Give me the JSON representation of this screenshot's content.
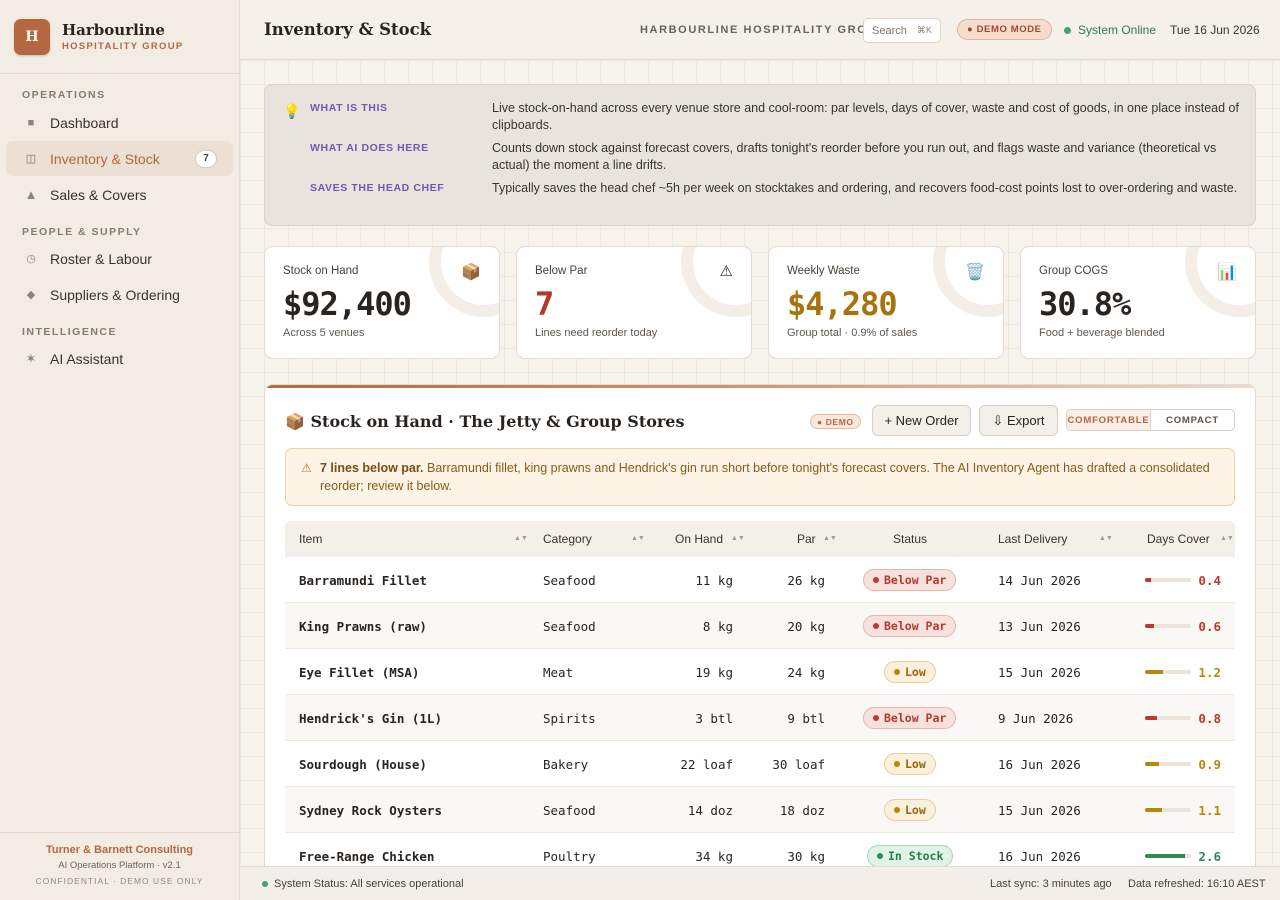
{
  "brand": {
    "initial": "H",
    "name": "Harbourline",
    "sub": "HOSPITALITY GROUP"
  },
  "sidebar": {
    "sections": [
      {
        "label": "OPERATIONS"
      },
      {
        "label": "PEOPLE & SUPPLY"
      },
      {
        "label": "INTELLIGENCE"
      }
    ],
    "items": [
      {
        "label": "Dashboard",
        "icon": "square-icon"
      },
      {
        "label": "Inventory & Stock",
        "icon": "layout-icon",
        "badge": "7",
        "active": true
      },
      {
        "label": "Sales & Covers",
        "icon": "triangle-icon"
      },
      {
        "label": "Roster & Labour",
        "icon": "clock-icon"
      },
      {
        "label": "Suppliers & Ordering",
        "icon": "diamond-icon"
      },
      {
        "label": "AI Assistant",
        "icon": "sparkle-icon"
      }
    ],
    "footer": {
      "company": "Turner & Barnett Consulting",
      "platform": "AI Operations Platform · v2.1",
      "note": "CONFIDENTIAL · DEMO USE ONLY"
    }
  },
  "header": {
    "title": "Inventory & Stock",
    "org": "HARBOURLINE HOSPITALITY GROUP",
    "search_label": "Search",
    "search_shortcut": "⌘K",
    "demo_mode": "● DEMO MODE",
    "system_status": "System Online",
    "date": "Tue 16 Jun 2026"
  },
  "info": {
    "rows": [
      {
        "key": "WHAT IS THIS",
        "value": "Live stock-on-hand across every venue store and cool-room: par levels, days of cover, waste and cost of goods, in one place instead of clipboards."
      },
      {
        "key": "WHAT AI DOES HERE",
        "value": "Counts down stock against forecast covers, drafts tonight's reorder before you run out, and flags waste and variance (theoretical vs actual) the moment a line drifts."
      },
      {
        "key": "SAVES THE HEAD CHEF",
        "value": "Typically saves the head chef ~5h per week on stocktakes and ordering, and recovers food-cost points lost to over-ordering and waste."
      }
    ]
  },
  "kpis": [
    {
      "label": "Stock on Hand",
      "icon": "package-icon",
      "value": "$92,400",
      "sub": "Across 5 venues",
      "color": "#2a2420"
    },
    {
      "label": "Below Par",
      "icon": "warning-icon",
      "value": "7",
      "sub": "Lines need reorder today",
      "color": "#b13a2c"
    },
    {
      "label": "Weekly Waste",
      "icon": "trash-icon",
      "value": "$4,280",
      "sub": "Group total · 0.9% of sales",
      "color": "#a8720c"
    },
    {
      "label": "Group COGS",
      "icon": "bar-chart-icon",
      "value": "30.8%",
      "sub": "Food + beverage blended",
      "color": "#2a2420"
    }
  ],
  "stock_card": {
    "title": "📦 Stock on Hand · The Jetty & Group Stores",
    "demo_badge": "● DEMO",
    "new_order": "+ New Order",
    "export": "⇩ Export",
    "density": {
      "comfortable": "COMFORTABLE",
      "compact": "COMPACT",
      "selected": "comfortable"
    },
    "alert": {
      "bold": "7 lines below par.",
      "text": " Barramundi fillet, king prawns and Hendrick's gin run short before tonight's forecast covers. The AI Inventory Agent has drafted a consolidated reorder; review it below."
    },
    "columns": [
      "Item",
      "Category",
      "On Hand",
      "Par",
      "Status",
      "Last Delivery",
      "Days Cover"
    ],
    "rows": [
      {
        "item": "Barramundi Fillet",
        "category": "Seafood",
        "on_hand": "11 kg",
        "par": "26 kg",
        "status": "Below Par",
        "last_delivery": "14 Jun 2026",
        "days_cover": "0.4"
      },
      {
        "item": "King Prawns (raw)",
        "category": "Seafood",
        "on_hand": "8 kg",
        "par": "20 kg",
        "status": "Below Par",
        "last_delivery": "13 Jun 2026",
        "days_cover": "0.6"
      },
      {
        "item": "Eye Fillet (MSA)",
        "category": "Meat",
        "on_hand": "19 kg",
        "par": "24 kg",
        "status": "Low",
        "last_delivery": "15 Jun 2026",
        "days_cover": "1.2"
      },
      {
        "item": "Hendrick's Gin (1L)",
        "category": "Spirits",
        "on_hand": "3 btl",
        "par": "9 btl",
        "status": "Below Par",
        "last_delivery": "9 Jun 2026",
        "days_cover": "0.8"
      },
      {
        "item": "Sourdough (House)",
        "category": "Bakery",
        "on_hand": "22 loaf",
        "par": "30 loaf",
        "status": "Low",
        "last_delivery": "16 Jun 2026",
        "days_cover": "0.9"
      },
      {
        "item": "Sydney Rock Oysters",
        "category": "Seafood",
        "on_hand": "14 doz",
        "par": "18 doz",
        "status": "Low",
        "last_delivery": "15 Jun 2026",
        "days_cover": "1.1"
      },
      {
        "item": "Free-Range Chicken",
        "category": "Poultry",
        "on_hand": "34 kg",
        "par": "30 kg",
        "status": "In Stock",
        "last_delivery": "16 Jun 2026",
        "days_cover": "2.6"
      }
    ]
  },
  "status_colors": {
    "Below Par": "#c0392b",
    "Low": "#b8860b",
    "In Stock": "#2e8b57"
  },
  "statusbar": {
    "status": "System Status: All services operational",
    "sync": "Last sync: 3 minutes ago",
    "refreshed": "Data refreshed: 16:10 AEST"
  }
}
